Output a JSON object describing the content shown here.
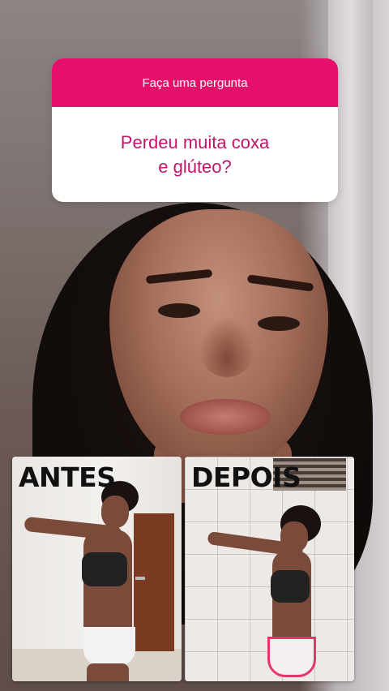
{
  "question_sticker": {
    "header": "Faça uma pergunta",
    "question_line1": "Perdeu muita coxa",
    "question_line2": "e glúteo?",
    "header_color": "#e4106a",
    "text_color": "#c2156b"
  },
  "comparison": {
    "before_label": "ANTES",
    "after_label": "DEPOIS"
  }
}
